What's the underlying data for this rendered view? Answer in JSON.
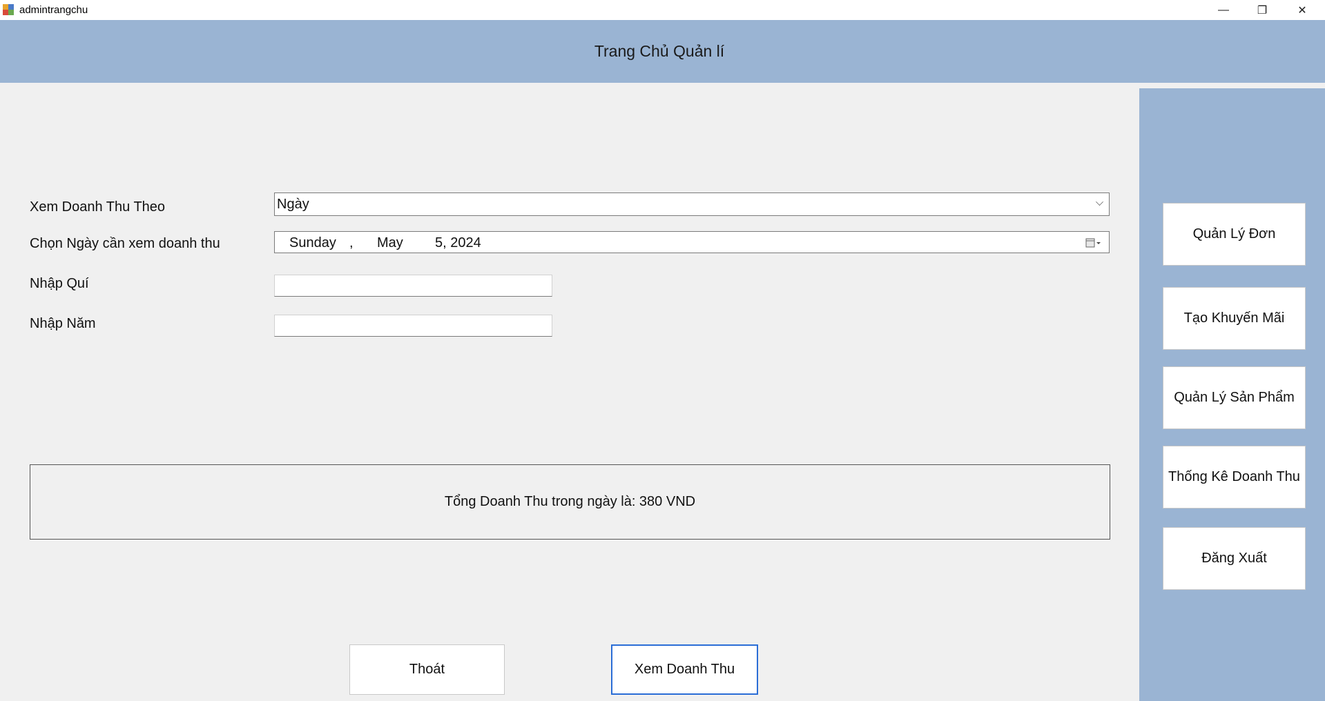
{
  "window": {
    "title": "admintrangchu",
    "minimize": "—",
    "restore": "❐",
    "close": "✕"
  },
  "header": {
    "title": "Trang Chủ Quản lí"
  },
  "form": {
    "revenue_by_label": "Xem Doanh Thu Theo",
    "revenue_by_value": "Ngày",
    "date_label": "Chọn Ngày cần xem doanh thu",
    "date_weekday": "Sunday",
    "date_sep": ",",
    "date_month": "May",
    "date_day_year": "5, 2024",
    "quarter_label": "Nhập Quí",
    "quarter_value": "",
    "year_label": "Nhập Năm",
    "year_value": ""
  },
  "result": {
    "text": "Tổng Doanh Thu trong ngày là: 380 VND"
  },
  "sidebar": {
    "items": [
      {
        "label": "Quản Lý Đơn"
      },
      {
        "label": "Tạo Khuyến Mãi"
      },
      {
        "label": "Quản Lý Sản Phẩm"
      },
      {
        "label": "Thống Kê Doanh Thu"
      },
      {
        "label": "Đăng Xuất"
      }
    ]
  },
  "actions": {
    "exit_label": "Thoát",
    "view_revenue_label": "Xem Doanh Thu"
  },
  "colors": {
    "header_bg": "#9ab4d3",
    "primary_border": "#2a6dd6"
  }
}
